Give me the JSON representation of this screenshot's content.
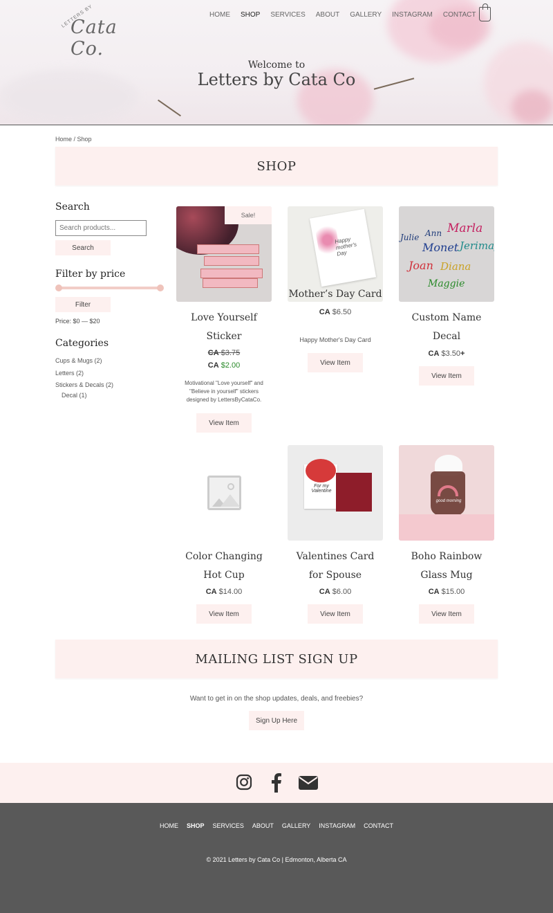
{
  "brand": {
    "logo_small": "LETTERS BY",
    "logo_script": "Cata Co."
  },
  "nav": [
    {
      "label": "HOME",
      "active": false
    },
    {
      "label": "SHOP",
      "active": true
    },
    {
      "label": "SERVICES",
      "active": false
    },
    {
      "label": "ABOUT",
      "active": false
    },
    {
      "label": "GALLERY",
      "active": false
    },
    {
      "label": "INSTAGRAM",
      "active": false
    },
    {
      "label": "CONTACT",
      "active": false
    }
  ],
  "hero": {
    "welcome_small": "Welcome to",
    "welcome_title": "Letters by Cata Co"
  },
  "breadcrumb": "Home / Shop",
  "shop_banner": "SHOP",
  "sidebar": {
    "search_heading": "Search",
    "search_placeholder": "Search products...",
    "search_button": "Search",
    "filter_heading": "Filter by price",
    "filter_button": "Filter",
    "price_range": "Price: $0 — $20",
    "categories_heading": "Categories",
    "categories": [
      {
        "label": "Cups & Mugs (2)"
      },
      {
        "label": "Letters (2)"
      },
      {
        "label": "Stickers & Decals (2)"
      },
      {
        "label": "Decal (1)"
      }
    ]
  },
  "products": [
    {
      "title_line1": "Love Yourself",
      "title_line2": "Sticker",
      "badge": "Sale!",
      "old_currency": "CA",
      "old_price": "$3.75",
      "currency": "CA",
      "price": "$2.00",
      "description": "Motivational \"Love yourself\" and \"Believe in yourself\" stickers designed by LettersByCataCo.",
      "button": "View Item",
      "image_icon": "love-sticker-image"
    },
    {
      "title_line1": "Mother’s Day Card",
      "title_line2": "",
      "currency": "CA",
      "price": "$6.50",
      "description": "Happy Mother's Day Card",
      "button": "View Item",
      "card_text": "Happy mother's Day",
      "image_icon": "mothers-day-card-image"
    },
    {
      "title_line1": "Custom Name",
      "title_line2": "Decal",
      "currency": "CA",
      "price": "$3.50",
      "price_suffix": "+",
      "button": "View Item",
      "image_icon": "name-decal-image",
      "decal_names": [
        "Julie",
        "Ann",
        "Marla",
        "Monet",
        "Jerimay",
        "Joan",
        "Diana",
        "Maggie"
      ]
    },
    {
      "title_line1": "Color Changing",
      "title_line2": "Hot Cup",
      "currency": "CA",
      "price": "$14.00",
      "button": "View Item",
      "image_icon": "placeholder-image-icon"
    },
    {
      "title_line1": "Valentines Card",
      "title_line2": "for Spouse",
      "currency": "CA",
      "price": "$6.00",
      "button": "View Item",
      "card_text": "For my Valentine",
      "image_icon": "valentine-card-image"
    },
    {
      "title_line1": "Boho Rainbow",
      "title_line2": "Glass Mug",
      "currency": "CA",
      "price": "$15.00",
      "button": "View Item",
      "mug_text": "good morning",
      "image_icon": "rainbow-mug-image"
    }
  ],
  "mailing": {
    "heading": "MAILING LIST SIGN UP",
    "text": "Want to get in on the shop updates, deals, and freebies?",
    "button": "Sign Up Here"
  },
  "social_icons": [
    "instagram-icon",
    "facebook-icon",
    "email-icon"
  ],
  "footer": {
    "nav": [
      {
        "label": "HOME",
        "active": false
      },
      {
        "label": "SHOP",
        "active": true
      },
      {
        "label": "SERVICES",
        "active": false
      },
      {
        "label": "ABOUT",
        "active": false
      },
      {
        "label": "GALLERY",
        "active": false
      },
      {
        "label": "INSTAGRAM",
        "active": false
      },
      {
        "label": "CONTACT",
        "active": false
      }
    ],
    "copyright": "© 2021 Letters by Cata Co | Edmonton, Alberta CA"
  },
  "colors": {
    "accent": "#fdf0ef",
    "footer": "#595959",
    "sale_green": "#2a8a2a"
  }
}
